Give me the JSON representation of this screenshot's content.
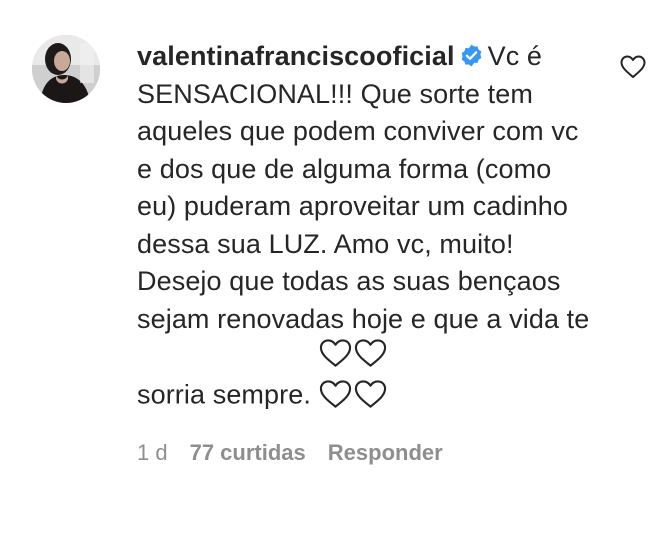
{
  "comment": {
    "username": "valentinafranciscooficial",
    "verified": true,
    "text": "Vc é SENSACIONAL!!! Que sorte tem aqueles que podem conviver com vc e dos que de alguma forma (como eu) puderam aproveitar um cadinho dessa sua LUZ. Amo vc, muito! Desejo que todas as suas bençaos sejam renovadas hoje e que a vida te sorria sempre.",
    "emoji_count": 4,
    "emoji": "white-heart"
  },
  "meta": {
    "time": "1 d",
    "likes": "77 curtidas",
    "reply_label": "Responder"
  },
  "colors": {
    "text": "#262626",
    "secondary": "#8e8e8e",
    "verified_blue": "#3897f0"
  },
  "icons": {
    "like": "heart-outline-icon",
    "verified": "verified-badge-icon"
  }
}
